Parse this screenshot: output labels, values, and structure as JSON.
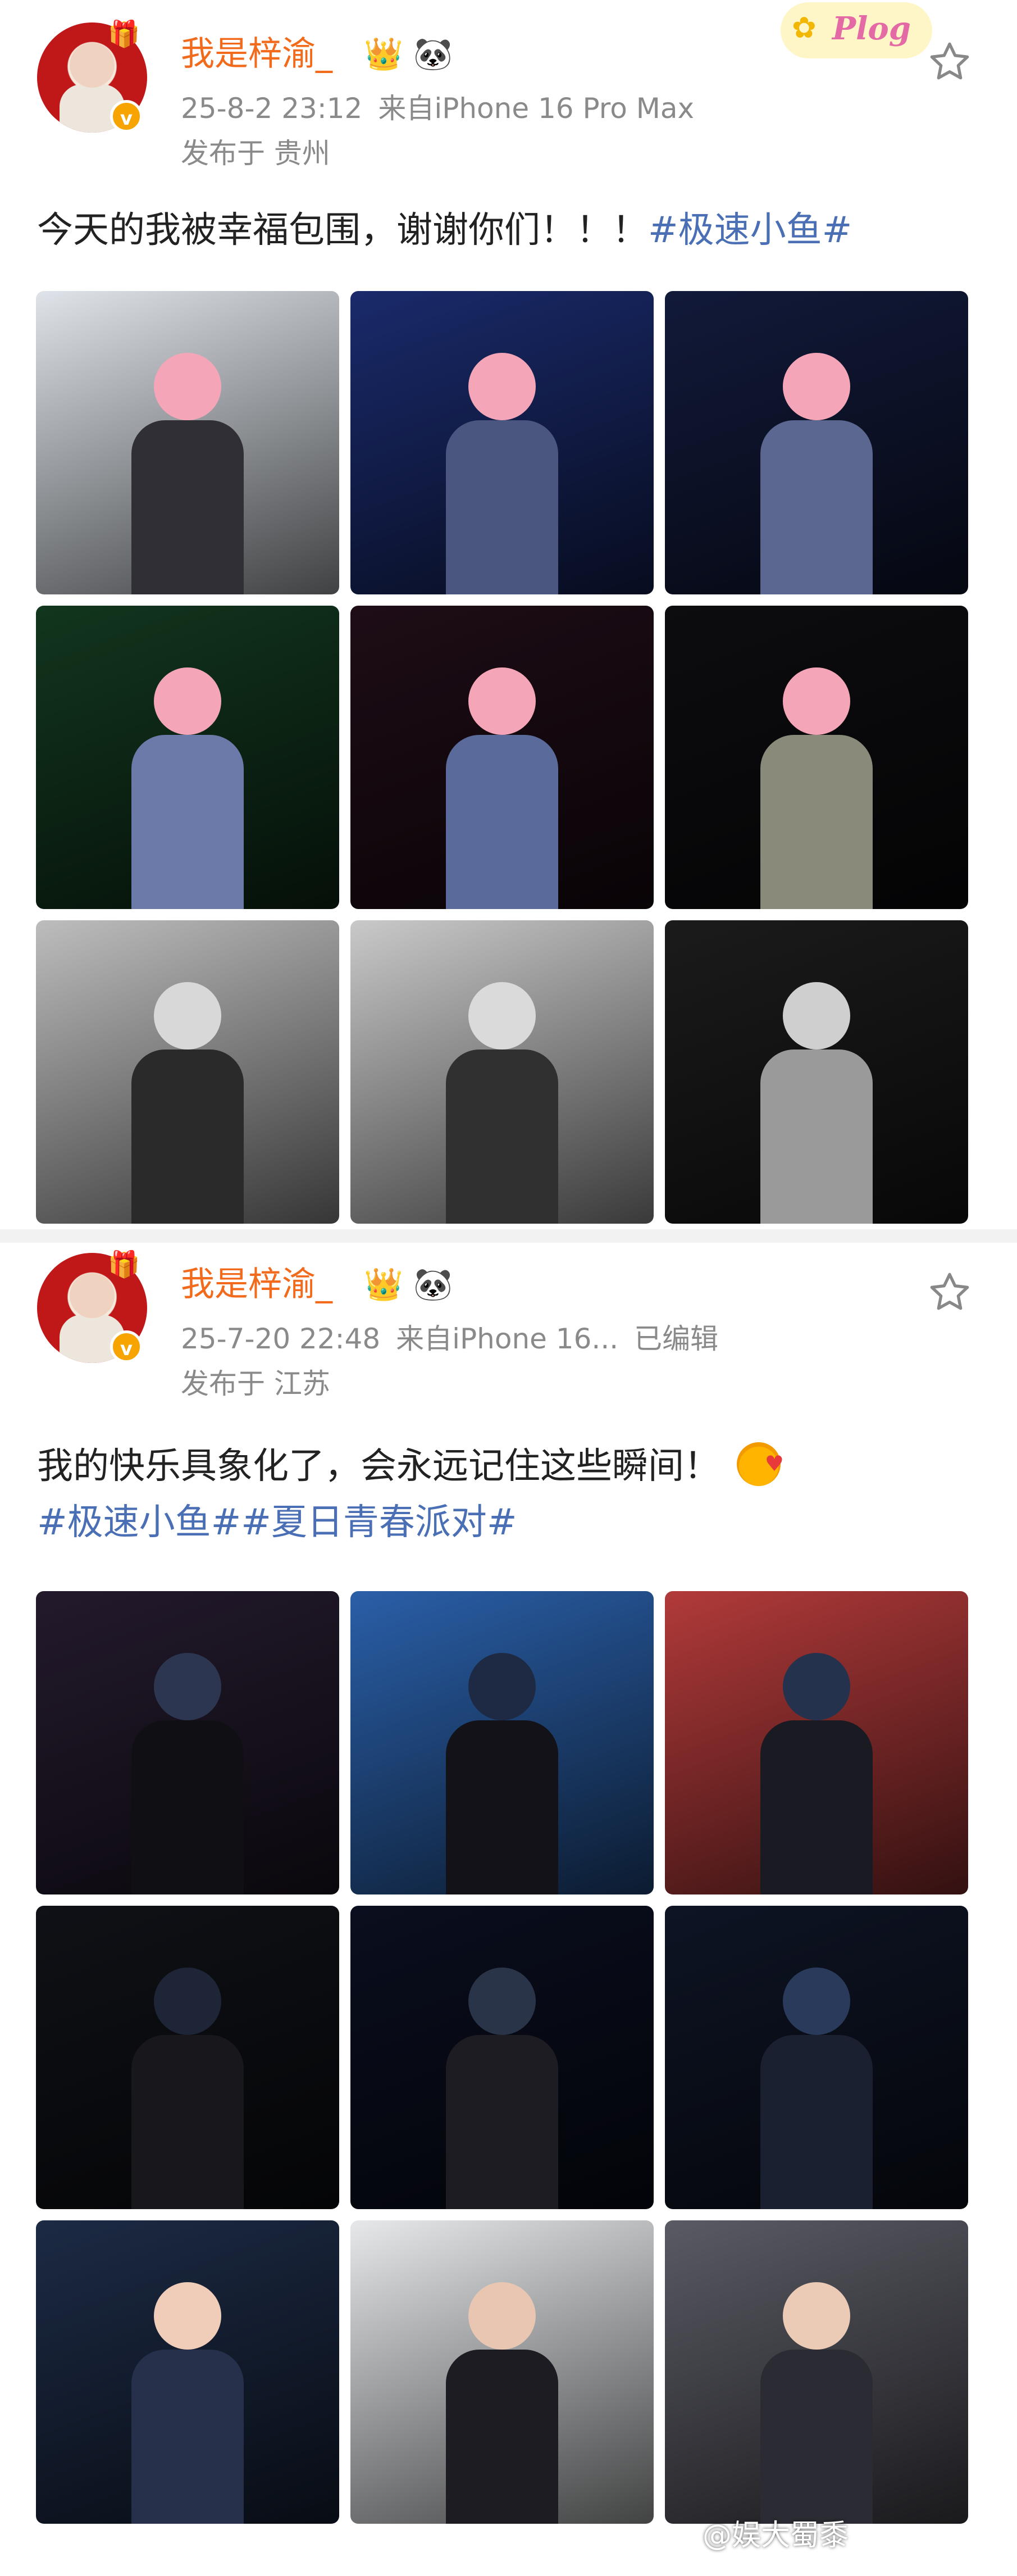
{
  "post1": {
    "username": "我是梓渝_",
    "name_icons": [
      "crown-icon",
      "panda-icon"
    ],
    "verified_mark": "v",
    "datetime": "25-8-2 23:12",
    "source": "来自iPhone 16 Pro Max",
    "location": "发布于 贵州",
    "badge_text": "Plog",
    "text": "今天的我被幸福包围，谢谢你们！！！",
    "hashtag": "#极速小鱼#",
    "photos": [
      {
        "alt": "pink-hair-portrait-closeup",
        "bg": "#dfe4ea",
        "head": "#f4a6b8",
        "body": "#2f2f35"
      },
      {
        "alt": "stage-singing-blue",
        "bg": "#1a2a6b",
        "head": "#f4a6b8",
        "body": "#4a5680"
      },
      {
        "alt": "stage-waving-dark",
        "bg": "#121a3a",
        "head": "#f4a6b8",
        "body": "#5b6790"
      },
      {
        "alt": "stage-green-screen",
        "bg": "#12361e",
        "head": "#f4a6b8",
        "body": "#6b7aa8"
      },
      {
        "alt": "stage-red-lights",
        "bg": "#1e0d16",
        "head": "#f4a6b8",
        "body": "#5a6a9a"
      },
      {
        "alt": "stage-back-view",
        "bg": "#0d0d10",
        "head": "#f4a6b8",
        "body": "#8a8a7a"
      },
      {
        "alt": "bw-portrait-1",
        "bg": "#bdbdbd",
        "head": "#d8d8d8",
        "body": "#2a2a2a"
      },
      {
        "alt": "bw-portrait-2",
        "bg": "#c9c9c9",
        "head": "#dadada",
        "body": "#303030"
      },
      {
        "alt": "bw-stage",
        "bg": "#1b1b1b",
        "head": "#cfcfcf",
        "body": "#9a9a9a"
      }
    ]
  },
  "post2": {
    "username": "我是梓渝_",
    "name_icons": [
      "crown-icon",
      "panda-icon"
    ],
    "verified_mark": "v",
    "datetime": "25-7-20 22:48",
    "source": "来自iPhone 16...",
    "edited": "已编辑",
    "location": "发布于 江苏",
    "text": "我的快乐具象化了，会永远记住这些瞬间！",
    "hashtags": "#极速小鱼##夏日青春派对#",
    "photos": [
      {
        "alt": "stage-purple-light",
        "bg": "#231a2c",
        "head": "#2c3650",
        "body": "#101014"
      },
      {
        "alt": "stage-blue-ok-sign",
        "bg": "#2a5fa8",
        "head": "#1e2a44",
        "body": "#121218"
      },
      {
        "alt": "stage-red-backdrop",
        "bg": "#b23a3a",
        "head": "#24324e",
        "body": "#1a1a22"
      },
      {
        "alt": "stage-dark-mic",
        "bg": "#0f1116",
        "head": "#1d2536",
        "body": "#18181c"
      },
      {
        "alt": "crowd-lights",
        "bg": "#0a0e1e",
        "head": "#2a3448",
        "body": "#1c1c22"
      },
      {
        "alt": "stage-peace-sign",
        "bg": "#0e1424",
        "head": "#2a3a5a",
        "body": "#1a2030"
      },
      {
        "alt": "blue-hair-closeup",
        "bg": "#1c2a44",
        "head": "#f0cdb8",
        "body": "#26304a"
      },
      {
        "alt": "guitar-photoshoot",
        "bg": "#e6e8ea",
        "head": "#e8c6b2",
        "body": "#1c1c22"
      },
      {
        "alt": "polka-dot-photoshoot",
        "bg": "#5a5a64",
        "head": "#ebcab6",
        "body": "#2b2b33"
      }
    ],
    "watermark": "@娱大蜀黍"
  }
}
